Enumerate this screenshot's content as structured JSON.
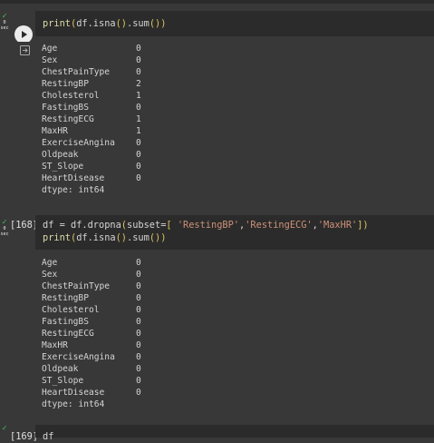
{
  "cell1": {
    "status_lines": [
      "0",
      "sec"
    ],
    "code": [
      [
        {
          "t": "print",
          "c": "fn"
        },
        {
          "t": "(",
          "c": "paren"
        },
        {
          "t": "df.isna",
          "c": "plain"
        },
        {
          "t": "()",
          "c": "paren"
        },
        {
          "t": ".sum",
          "c": "plain"
        },
        {
          "t": "())",
          "c": "paren"
        }
      ]
    ],
    "output": [
      {
        "name": "Age",
        "value": "0"
      },
      {
        "name": "Sex",
        "value": "0"
      },
      {
        "name": "ChestPainType",
        "value": "0"
      },
      {
        "name": "RestingBP",
        "value": "2"
      },
      {
        "name": "Cholesterol",
        "value": "1"
      },
      {
        "name": "FastingBS",
        "value": "0"
      },
      {
        "name": "RestingECG",
        "value": "1"
      },
      {
        "name": "MaxHR",
        "value": "1"
      },
      {
        "name": "ExerciseAngina",
        "value": "0"
      },
      {
        "name": "Oldpeak",
        "value": "0"
      },
      {
        "name": "ST_Slope",
        "value": "0"
      },
      {
        "name": "HeartDisease",
        "value": "0"
      }
    ],
    "dtype": "dtype: int64"
  },
  "cell2": {
    "exec_count": "[168]",
    "status_lines": [
      "0",
      "sec"
    ],
    "code": [
      [
        {
          "t": "df = df.dropna",
          "c": "plain"
        },
        {
          "t": "(",
          "c": "paren"
        },
        {
          "t": "subset=",
          "c": "plain"
        },
        {
          "t": "[",
          "c": "paren"
        },
        {
          "t": " ",
          "c": "plain"
        },
        {
          "t": "'RestingBP'",
          "c": "str"
        },
        {
          "t": ",",
          "c": "plain"
        },
        {
          "t": "'RestingECG'",
          "c": "str"
        },
        {
          "t": ",",
          "c": "plain"
        },
        {
          "t": "'MaxHR'",
          "c": "str"
        },
        {
          "t": "])",
          "c": "paren"
        }
      ],
      [
        {
          "t": "print",
          "c": "fn"
        },
        {
          "t": "(",
          "c": "paren"
        },
        {
          "t": "df.isna",
          "c": "plain"
        },
        {
          "t": "()",
          "c": "paren"
        },
        {
          "t": ".sum",
          "c": "plain"
        },
        {
          "t": "())",
          "c": "paren"
        }
      ]
    ],
    "output": [
      {
        "name": "Age",
        "value": "0"
      },
      {
        "name": "Sex",
        "value": "0"
      },
      {
        "name": "ChestPainType",
        "value": "0"
      },
      {
        "name": "RestingBP",
        "value": "0"
      },
      {
        "name": "Cholesterol",
        "value": "0"
      },
      {
        "name": "FastingBS",
        "value": "0"
      },
      {
        "name": "RestingECG",
        "value": "0"
      },
      {
        "name": "MaxHR",
        "value": "0"
      },
      {
        "name": "ExerciseAngina",
        "value": "0"
      },
      {
        "name": "Oldpeak",
        "value": "0"
      },
      {
        "name": "ST_Slope",
        "value": "0"
      },
      {
        "name": "HeartDisease",
        "value": "0"
      }
    ],
    "dtype": "dtype: int64"
  },
  "cell3": {
    "exec_count": "[169]",
    "code_line": "df"
  },
  "colors": {
    "background": "#383838",
    "code_cell": "#2b2b2b",
    "success_check": "#3fbf5a",
    "function": "#dcdcaa",
    "bracket": "#dbc45c",
    "string": "#ce9178"
  },
  "icons": {
    "run": "play-circle-icon",
    "output": "output-arrow-icon",
    "status": "check-icon"
  }
}
